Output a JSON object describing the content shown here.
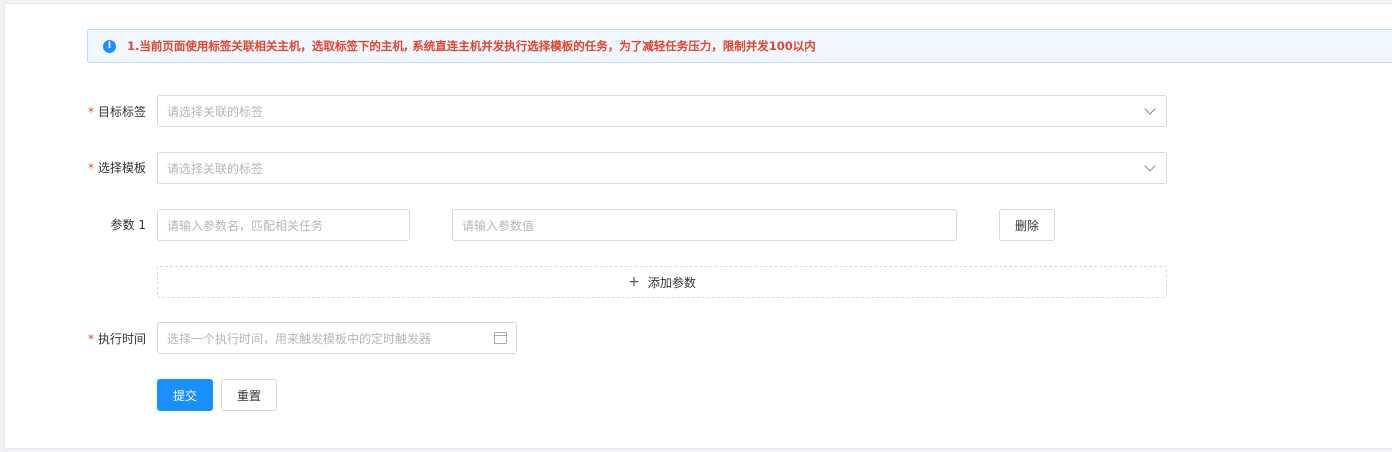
{
  "alert": {
    "icon": "info-icon",
    "message": "1.当前页面使用标签关联相关主机，选取标签下的主机, 系统直连主机并发执行选择模板的任务，为了减轻任务压力，限制并发100以内"
  },
  "form": {
    "required_mark": "*",
    "target_tag": {
      "label": "目标标签",
      "placeholder": "请选择关联的标签"
    },
    "template": {
      "label": "选择模板",
      "placeholder": "请选择关联的标签"
    },
    "param": {
      "label": "参数 1",
      "name_placeholder": "请输入参数名，匹配相关任务",
      "value_placeholder": "请输入参数值",
      "delete_label": "删除"
    },
    "add_param_label": "添加参数",
    "exec_time": {
      "label": "执行时间",
      "placeholder": "选择一个执行时间，用来触发模板中的定时触发器"
    },
    "submit_label": "提交",
    "reset_label": "重置"
  },
  "colors": {
    "accent": "#1890ff",
    "required": "#e2452b"
  }
}
